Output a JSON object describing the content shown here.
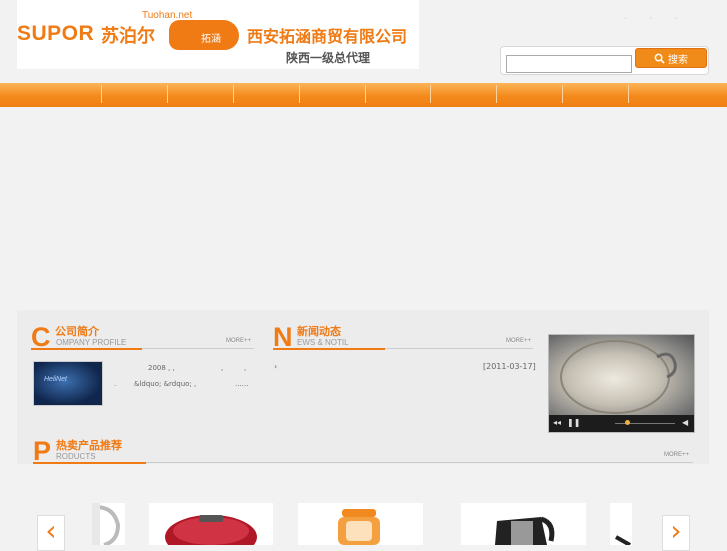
{
  "header": {
    "brand_latin": "SUPOR",
    "brand_cn": "苏泊尔",
    "site": "Tuohan.net",
    "blob_text": "拓涵",
    "company": "西安拓涵商贸有限公司",
    "company_sub": "陕西一级总代理",
    "top_dots": "· · ·"
  },
  "search": {
    "placeholder": "",
    "button_label": "搜索"
  },
  "nav": {
    "items": [
      "",
      "",
      "",
      "",
      "",
      "",
      "",
      "",
      "",
      ""
    ]
  },
  "profile": {
    "letter": "C",
    "title": "公司简介",
    "sub": "OMPANY PROFILE",
    "more": "MORE++",
    "image_text": "HeliNet",
    "line1": "2008 ,  ,",
    "line1b": ",",
    "line1c": ",",
    "line2a": ".",
    "line2b": "&ldquo;  &rdquo; ,",
    "line2c": "......"
  },
  "news": {
    "letter": "N",
    "title": "新闻动态",
    "sub": "EWS & NOTIL",
    "more": "MORE++",
    "bullet": "›",
    "date": "[2011-03-17]"
  },
  "products": {
    "letter": "P",
    "title": "热卖产品推荐",
    "sub": "RODUCTS",
    "more": "MORE++"
  },
  "video": {
    "rewind": "◂◂",
    "pause": "❚❚",
    "volume": "◀"
  },
  "carousel": {
    "prev": "‹",
    "next": "›"
  },
  "colors": {
    "accent": "#f07a14",
    "nav": "#f48a1c"
  }
}
